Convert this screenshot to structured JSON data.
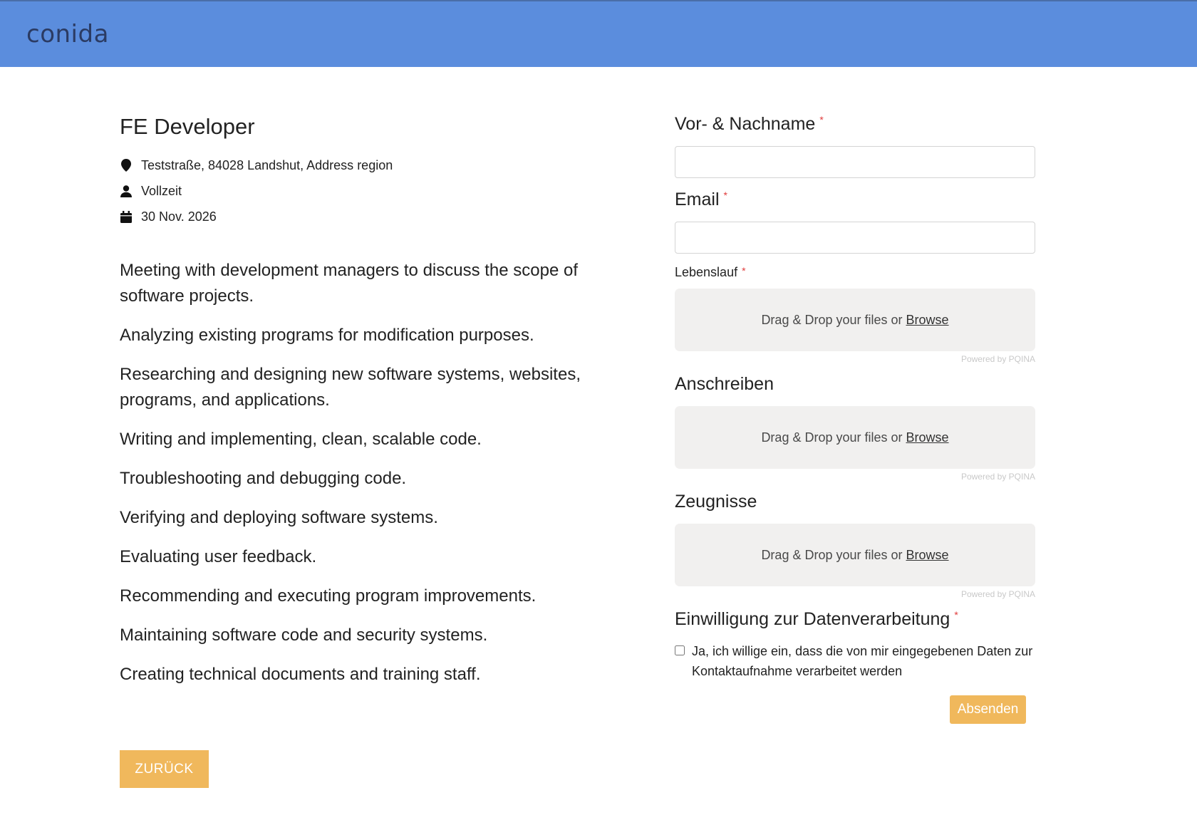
{
  "header": {
    "logo": "conida",
    "bg_color": "#5b8ddd"
  },
  "job": {
    "title": "FE Developer",
    "location": "Teststraße, 84028 Landshut, Address region",
    "employment_type": "Vollzeit",
    "date": "30 Nov. 2026",
    "description": [
      "Meeting with development managers to discuss the scope of software projects.",
      "Analyzing existing programs for modification purposes.",
      "Researching and designing new software systems, websites, programs, and applications.",
      "Writing and implementing, clean, scalable code.",
      "Troubleshooting and debugging code.",
      "Verifying and deploying software systems.",
      "Evaluating user feedback.",
      "Recommending and executing program improvements.",
      "Maintaining software code and security systems.",
      "Creating technical documents and training staff."
    ],
    "back_label": "ZURÜCK"
  },
  "form": {
    "name_label": "Vor- & Nachname",
    "name_value": "",
    "email_label": "Email",
    "email_value": "",
    "required_mark": "*",
    "cv_label": "Lebenslauf",
    "cover_label": "Anschreiben",
    "certs_label": "Zeugnisse",
    "dropzone_text": "Drag & Drop your files or",
    "dropzone_browse": "Browse",
    "powered_by": "Powered by PQINA",
    "consent_label": "Einwilligung zur Datenverarbeitung",
    "consent_text": "Ja, ich willige ein, dass die von mir eingegebenen Daten zur Kontaktaufnahme verarbeitet werden",
    "consent_checked": false,
    "submit_label": "Absenden"
  },
  "colors": {
    "accent": "#f0b85c",
    "required": "#e03b3b"
  }
}
